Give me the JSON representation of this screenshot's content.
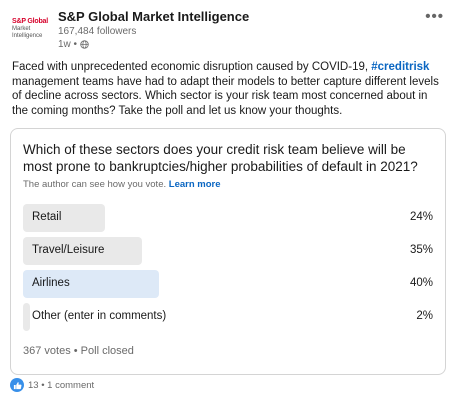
{
  "post": {
    "logo_lines": [
      "S&P Global",
      "Market",
      "Intelligence"
    ],
    "company": "S&P Global Market Intelligence",
    "followers": "167,484 followers",
    "time": "1w •",
    "menu": "•••",
    "text_before": "Faced with unprecedented economic disruption caused by COVID-19, ",
    "hashtag": "#creditrisk",
    "text_after": " management teams have had to adapt their models to better capture different levels of decline across sectors. Which sector is your risk team most concerned about in the coming months? Take the poll and let us know your thoughts."
  },
  "poll": {
    "question": "Which of these sectors does your credit risk team believe will be most prone to bankruptcies/higher probabilities of default in 2021?",
    "author_note": "The author can see how you vote.",
    "learn_more": "Learn more",
    "options": [
      {
        "label": "Retail",
        "percent_text": "24%",
        "percent": 24,
        "selected": false
      },
      {
        "label": "Travel/Leisure",
        "percent_text": "35%",
        "percent": 35,
        "selected": false
      },
      {
        "label": "Airlines",
        "percent_text": "40%",
        "percent": 40,
        "selected": true
      },
      {
        "label": "Other (enter in comments)",
        "percent_text": "2%",
        "percent": 2,
        "selected": false
      }
    ],
    "summary": "367 votes • Poll closed"
  },
  "social": {
    "counts": "13 • 1 comment"
  },
  "colors": {
    "link": "#0a66c2",
    "bar": "#e9e9e9",
    "bar_selected": "#dde9f7",
    "like": "#378fe9"
  },
  "icons": [
    "globe-icon",
    "like-icon",
    "more-menu-icon"
  ]
}
